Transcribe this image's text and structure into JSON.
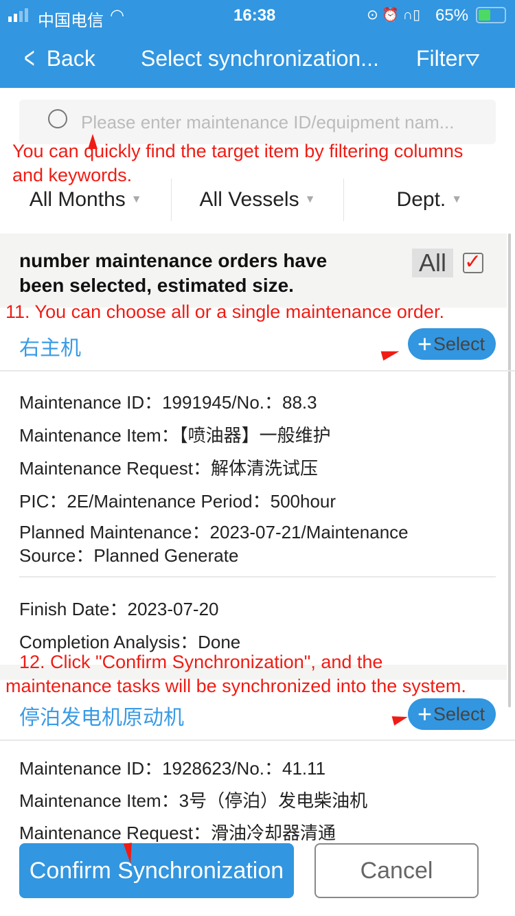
{
  "status_bar": {
    "carrier": "中国电信",
    "time": "16:38",
    "battery": "65%",
    "battery_level": 0.65
  },
  "nav": {
    "back": "Back",
    "title": "Select synchronization...",
    "filter": "Filter"
  },
  "search": {
    "placeholder": "Please enter maintenance ID/equipment nam..."
  },
  "annotations": {
    "a1": "You can quickly find the target item by filtering columns",
    "a1b": "and keywords.",
    "a11": "11. You can choose all or a single maintenance order.",
    "a12": "12. Click \"Confirm Synchronization\", and the",
    "a12b": "maintenance tasks will be synchronized into the system."
  },
  "filters": [
    "All Months",
    "All Vessels",
    "Dept."
  ],
  "selection": {
    "line1": "number maintenance orders have",
    "line2": "been selected, estimated size.",
    "all_label": "All",
    "all_checked": true
  },
  "groups": [
    {
      "title": "右主机",
      "select": "Select",
      "lines": [
        "Maintenance ID：1991945/No.：88.3",
        "Maintenance Item：【喷油器】一般维护",
        "Maintenance Request：解体清洗试压",
        "PIC：2E/Maintenance Period：500hour",
        "Planned Maintenance：2023-07-21/Maintenance",
        "Source：Planned Generate"
      ],
      "finish": [
        "Finish Date：2023-07-20",
        "Completion Analysis：Done"
      ]
    },
    {
      "title": "停泊发电机原动机",
      "select": "Select",
      "lines": [
        "Maintenance ID：1928623/No.：41.11",
        "Maintenance Item：3号（停泊）发电柴油机",
        "Maintenance Request：滑油冷却器清通"
      ]
    }
  ],
  "footer": {
    "confirm": "Confirm Synchronization",
    "cancel": "Cancel"
  },
  "colors": {
    "primary": "#3296e0",
    "annotation": "#f01c14",
    "group_title": "#3a9be5"
  }
}
